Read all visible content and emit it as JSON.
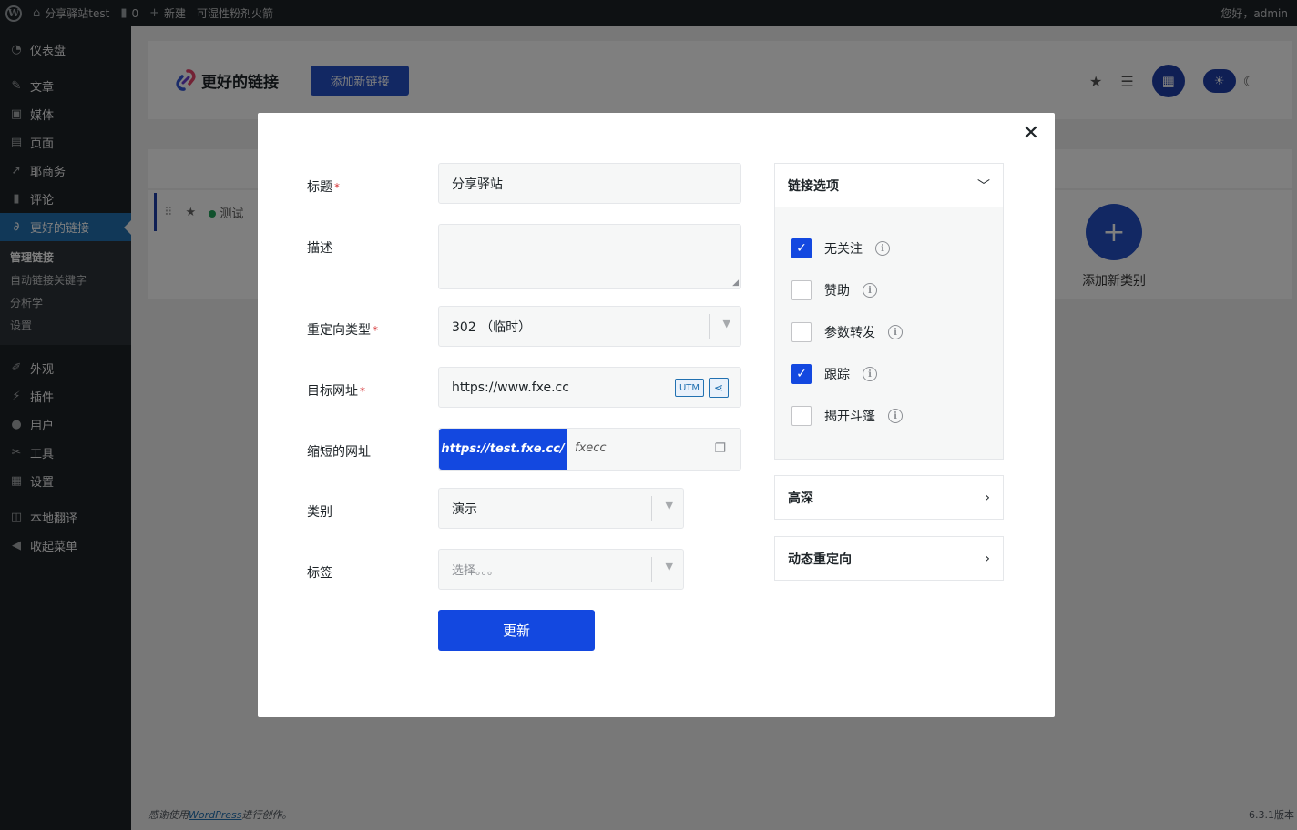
{
  "adminbar": {
    "site_name": "分享驿站test",
    "comments_count": "0",
    "new_label": "新建",
    "plugin_item": "可湿性粉剂火箭",
    "greeting": "您好，admin"
  },
  "sidebar": {
    "items": [
      {
        "label": "仪表盘",
        "icon": "dashboard-icon"
      },
      {
        "label": "文章",
        "icon": "pin-icon"
      },
      {
        "label": "媒体",
        "icon": "media-icon"
      },
      {
        "label": "页面",
        "icon": "page-icon"
      },
      {
        "label": "耶商务",
        "icon": "send-icon"
      },
      {
        "label": "评论",
        "icon": "comment-icon"
      },
      {
        "label": "更好的链接",
        "icon": "link-icon"
      }
    ],
    "submenu": [
      "管理链接",
      "自动链接关键字",
      "分析学",
      "设置"
    ],
    "items2": [
      {
        "label": "外观",
        "icon": "brush-icon"
      },
      {
        "label": "插件",
        "icon": "plugin-icon"
      },
      {
        "label": "用户",
        "icon": "user-icon"
      },
      {
        "label": "工具",
        "icon": "wrench-icon"
      },
      {
        "label": "设置",
        "icon": "settings-icon"
      },
      {
        "label": "本地翻译",
        "icon": "translate-icon"
      },
      {
        "label": "收起菜单",
        "icon": "collapse-icon"
      }
    ]
  },
  "header": {
    "brand": "更好的链接",
    "add_link": "添加新链接"
  },
  "list": {
    "row_title": "测试",
    "add_category": "添加新类别"
  },
  "footer": {
    "thanks_prefix": "感谢使用",
    "wordpress": "WordPress",
    "thanks_suffix": "进行创作。",
    "version": "6.3.1版本"
  },
  "modal": {
    "labels": {
      "title": "标题",
      "description": "描述",
      "redirect_type": "重定向类型",
      "target_url": "目标网址",
      "short_url": "缩短的网址",
      "category": "类别",
      "tags": "标签"
    },
    "required_mark": "*",
    "values": {
      "title": "分享驿站",
      "description": "",
      "redirect_type": "302 （临时）",
      "target_url": "https://www.fxe.cc",
      "utm": "UTM",
      "short_prefix": "https://test.fxe.cc/",
      "short_slug": "fxecc",
      "category": "演示",
      "tags_placeholder": "选择。。。"
    },
    "update_button": "更新",
    "panels": {
      "link_options": "链接选项",
      "advanced": "高深",
      "dynamic_redirect": "动态重定向"
    },
    "options": [
      {
        "label": "无关注",
        "checked": true
      },
      {
        "label": "赞助",
        "checked": false
      },
      {
        "label": "参数转发",
        "checked": false
      },
      {
        "label": "跟踪",
        "checked": true
      },
      {
        "label": "揭开斗篷",
        "checked": false
      }
    ]
  }
}
